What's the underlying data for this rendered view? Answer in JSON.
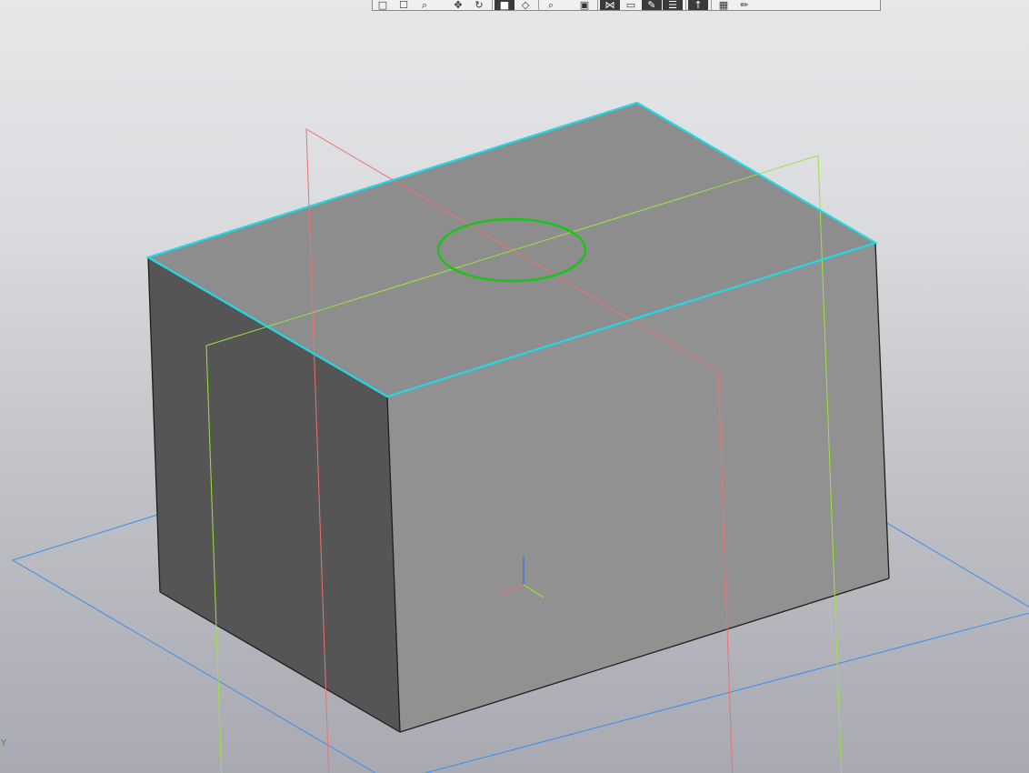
{
  "app": {
    "view_mode": "3D model view",
    "colors": {
      "background_top": "#e6e7e9",
      "background_bottom": "#a8a9b1",
      "top_face": "#8d8d8d",
      "front_face": "#919191",
      "side_face": "#555555",
      "selected_edge": "#1fd9e6",
      "sketch_circle": "#19c419",
      "plane_xy": "#3a8df0",
      "plane_zy": "#f07070",
      "plane_zx": "#9be33c"
    }
  },
  "toolbar": {
    "buttons": [
      {
        "icon": "partial-hidden-icon",
        "active": false
      },
      {
        "icon": "zoom-frame-icon",
        "active": false
      },
      {
        "icon": "zoom-icon",
        "active": false
      },
      {
        "icon": "gap",
        "active": false
      },
      {
        "icon": "pan-icon",
        "active": false
      },
      {
        "icon": "rotate-icon",
        "active": false
      },
      {
        "icon": "sep",
        "active": false
      },
      {
        "icon": "shaded-icon",
        "active": true
      },
      {
        "icon": "wireframe-icon",
        "active": false
      },
      {
        "icon": "sep",
        "active": false
      },
      {
        "icon": "zoom-to-fit-icon",
        "active": false
      },
      {
        "icon": "gap",
        "active": false
      },
      {
        "icon": "section-icon",
        "active": false
      },
      {
        "icon": "sep",
        "active": false
      },
      {
        "icon": "constraints-icon",
        "active": true
      },
      {
        "icon": "sketch-icon",
        "active": false
      },
      {
        "icon": "edit-icon",
        "active": true
      },
      {
        "icon": "properties-icon",
        "active": true
      },
      {
        "icon": "sep",
        "active": false
      },
      {
        "icon": "pointer-icon",
        "active": true
      },
      {
        "icon": "sep",
        "active": false
      },
      {
        "icon": "table-icon",
        "active": false
      },
      {
        "icon": "pencil-icon",
        "active": false
      }
    ]
  },
  "triad_label": "Y"
}
